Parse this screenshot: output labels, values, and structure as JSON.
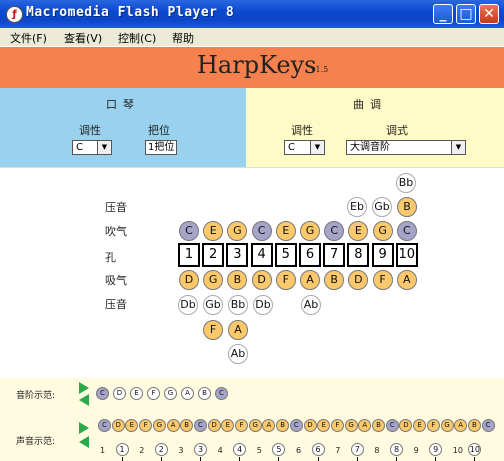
{
  "window": {
    "title": "Macromedia Flash Player 8"
  },
  "menu": [
    {
      "label": "文件(F)"
    },
    {
      "label": "查看(V)"
    },
    {
      "label": "控制(C)"
    },
    {
      "label": "帮助"
    }
  ],
  "banner": {
    "title": "HarpKeys",
    "version": "v1.5"
  },
  "left_panel": {
    "title": "口琴",
    "key_label": "调性",
    "key_value": "C",
    "position_label": "把位",
    "position_value": "1把位"
  },
  "right_panel": {
    "title": "曲调",
    "key_label": "调性",
    "key_value": "C",
    "mode_label": "调式",
    "mode_value": "大调音阶"
  },
  "rows": {
    "blow_bend": "压音",
    "blow": "吹气",
    "hole": "孔",
    "draw": "吸气",
    "draw_bend": "压音"
  },
  "holes": [
    "1",
    "2",
    "3",
    "4",
    "5",
    "6",
    "7",
    "8",
    "9",
    "10"
  ],
  "blow_notes": [
    "C",
    "E",
    "G",
    "C",
    "E",
    "G",
    "C",
    "E",
    "G",
    "C"
  ],
  "blow_styles": [
    "purple",
    "orange",
    "orange",
    "purple",
    "orange",
    "orange",
    "purple",
    "orange",
    "orange",
    "purple"
  ],
  "draw_notes": [
    "D",
    "G",
    "B",
    "D",
    "F",
    "A",
    "B",
    "D",
    "F",
    "A"
  ],
  "blow_bends": {
    "bb": "Bb",
    "eb": "Eb",
    "gb": "Gb",
    "b": "B"
  },
  "draw_bends": {
    "db1": "Db",
    "gb2": "Gb",
    "bb3": "Bb",
    "db4": "Db",
    "ab6": "Ab",
    "f3": "F",
    "a3": "A",
    "ab3": "Ab"
  },
  "scale_demo": {
    "label": "音阶示范:",
    "notes": [
      "C",
      "D",
      "E",
      "F",
      "G",
      "A",
      "B",
      "C"
    ],
    "styles": [
      "purple",
      "white",
      "white",
      "white",
      "white",
      "white",
      "white",
      "purple"
    ]
  },
  "sound_demo": {
    "label": "声音示范:",
    "notes": [
      "C",
      "D",
      "E",
      "F",
      "G",
      "A",
      "B",
      "C",
      "D",
      "E",
      "F",
      "G",
      "A",
      "B",
      "C",
      "D",
      "E",
      "F",
      "G",
      "A",
      "B",
      "C",
      "D",
      "E",
      "F",
      "G",
      "A",
      "B",
      "C"
    ],
    "styles": [
      "purple",
      "orange",
      "orange",
      "orange",
      "orange",
      "orange",
      "orange",
      "purple",
      "orange",
      "orange",
      "orange",
      "orange",
      "orange",
      "orange",
      "purple",
      "orange",
      "orange",
      "orange",
      "orange",
      "orange",
      "orange",
      "purple",
      "orange",
      "orange",
      "orange",
      "orange",
      "orange",
      "orange",
      "purple"
    ],
    "holes": [
      "1",
      "1",
      "2",
      "2",
      "3",
      "3",
      "4",
      "4",
      "5",
      "5",
      "6",
      "6",
      "7",
      "7",
      "8",
      "8",
      "9",
      "9",
      "10",
      "10"
    ]
  }
}
